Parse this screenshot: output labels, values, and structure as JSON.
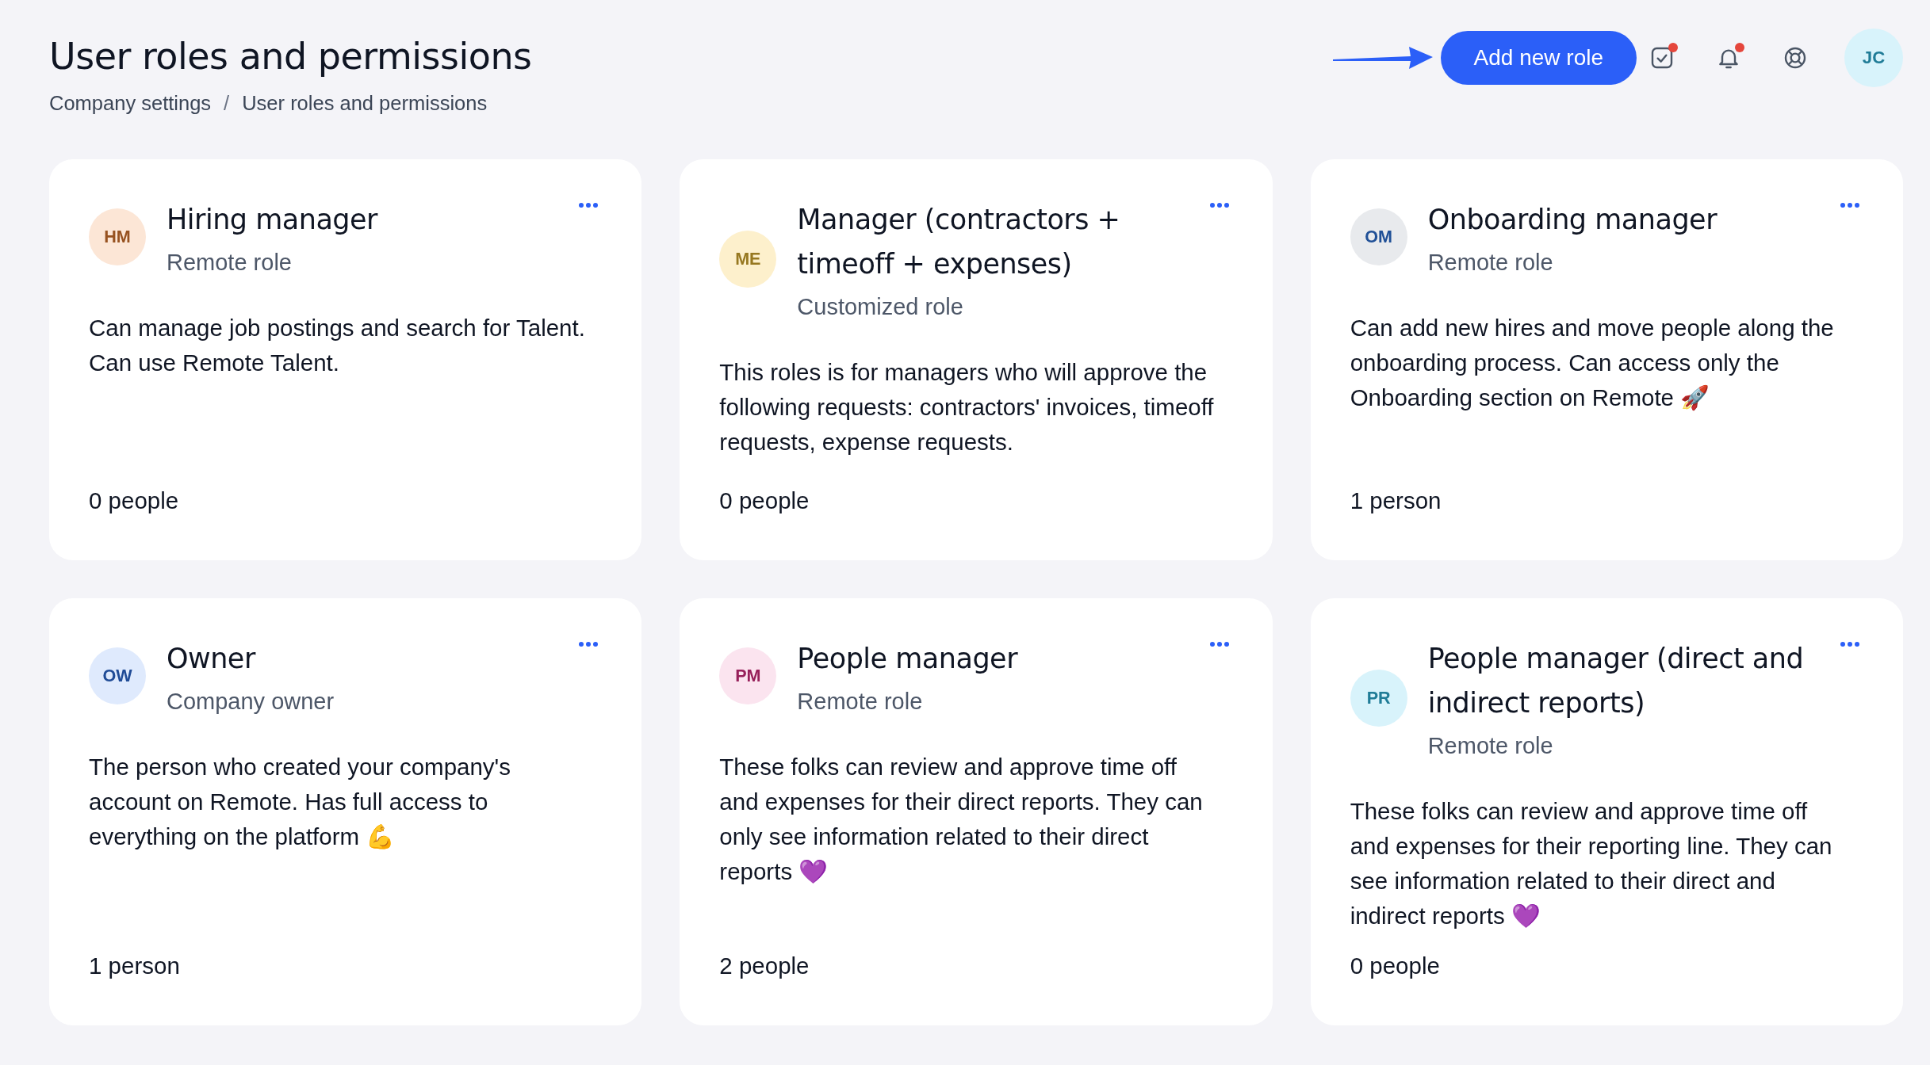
{
  "page": {
    "title": "User roles and permissions",
    "breadcrumb": [
      "Company settings",
      "User roles and permissions"
    ],
    "breadcrumb_separator": "/"
  },
  "header": {
    "add_button": "Add new role",
    "tasks_badge": true,
    "notifications_badge": true,
    "user": {
      "initials": "JC",
      "color": "#d8f3fb"
    }
  },
  "roles": [
    {
      "initials": "HM",
      "color": "#fce6d6",
      "name": "Hiring manager",
      "type": "Remote role",
      "description": "Can manage job postings and search for Talent. Can use Remote Talent.",
      "count": "0 people"
    },
    {
      "initials": "ME",
      "color": "#fdf0cc",
      "name": "Manager (contractors + timeoff + expenses)",
      "type": "Customized role",
      "description": "This roles is for managers who will approve the following requests: contractors' invoices, timeoff requests, expense requests.",
      "count": "0 people"
    },
    {
      "initials": "OM",
      "color": "#e8eaed",
      "name": "Onboarding manager",
      "type": "Remote role",
      "description": "Can add new hires and move people along the onboarding process. Can access only the Onboarding section on Remote 🚀",
      "count": "1 person"
    },
    {
      "initials": "OW",
      "color": "#dfeafd",
      "name": "Owner",
      "type": "Company owner",
      "description": "The person who created your company's account on Remote. Has full access to everything on the platform 💪",
      "count": "1 person"
    },
    {
      "initials": "PM",
      "color": "#fbe4ef",
      "name": "People manager",
      "type": "Remote role",
      "description": "These folks can review and approve time off and expenses for their direct reports. They can only see information related to their direct reports 💜",
      "count": "2 people"
    },
    {
      "initials": "PR",
      "color": "#d8f3fb",
      "name": "People manager (direct and indirect reports)",
      "type": "Remote role",
      "description": "These folks can review and approve time off and expenses for their reporting line. They can see information related to their direct and indirect reports 💜",
      "count": "0 people"
    }
  ]
}
